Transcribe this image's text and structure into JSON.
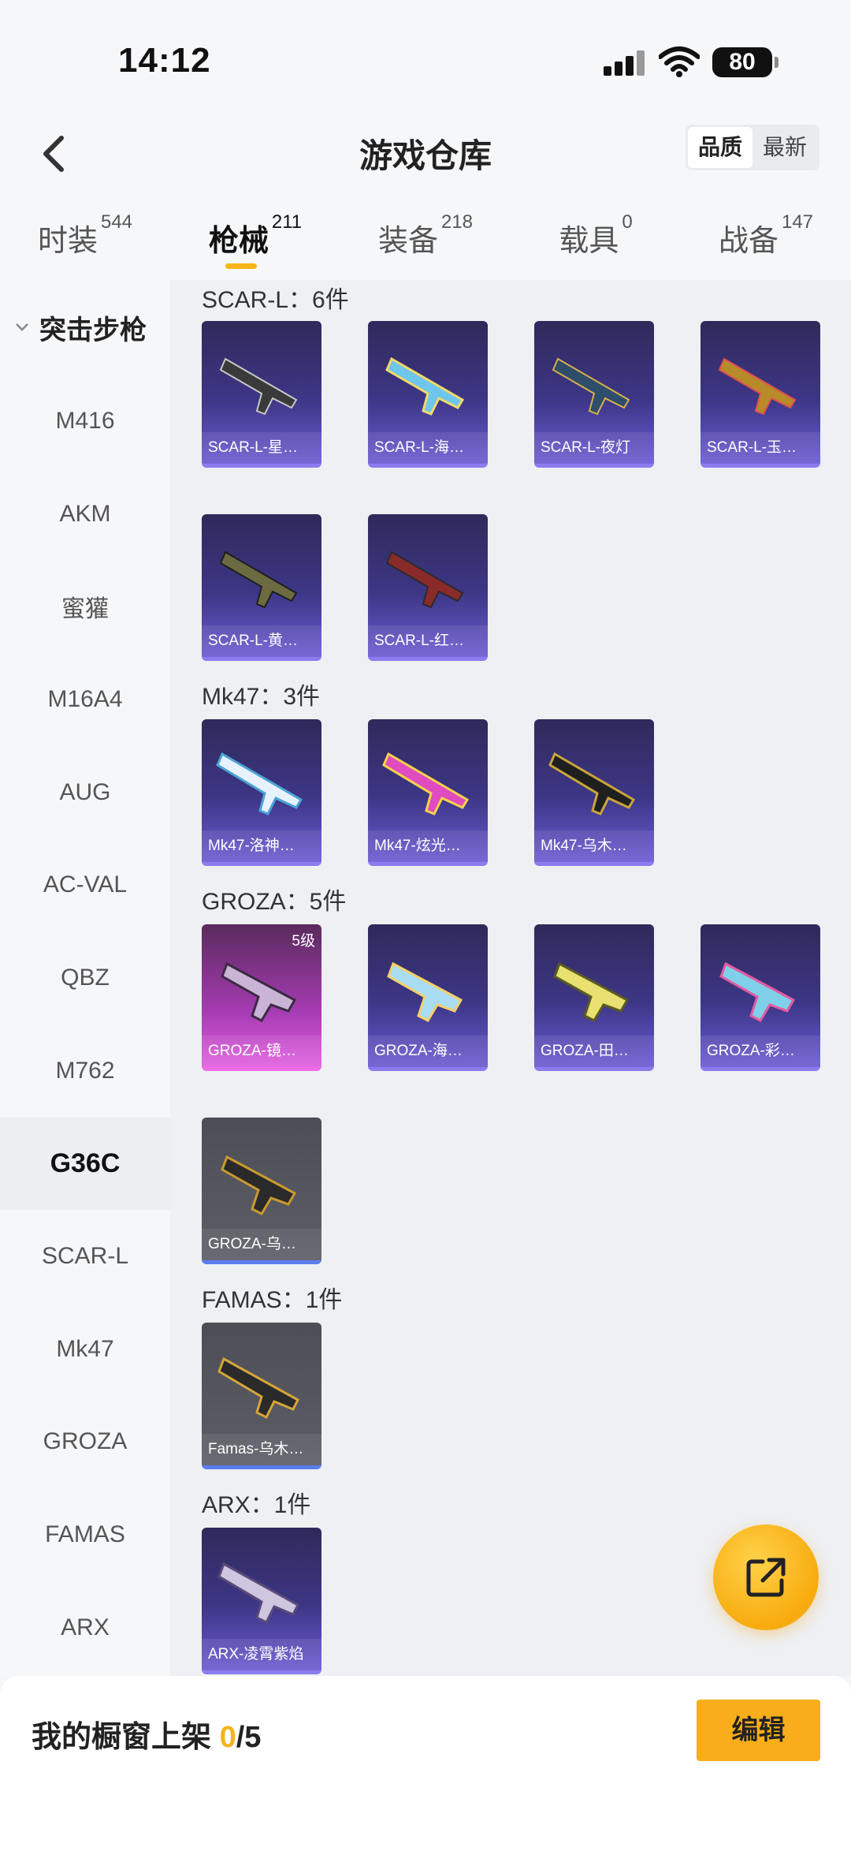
{
  "status_bar": {
    "time": "14:12",
    "battery": "80"
  },
  "header": {
    "title": "游戏仓库",
    "sort_options": [
      "品质",
      "最新"
    ]
  },
  "tabs": [
    {
      "label": "时装",
      "count": "544"
    },
    {
      "label": "枪械",
      "count": "211"
    },
    {
      "label": "装备",
      "count": "218"
    },
    {
      "label": "载具",
      "count": "0"
    },
    {
      "label": "战备",
      "count": "147"
    }
  ],
  "sidebar": {
    "category": "突击步枪",
    "items": [
      "M416",
      "AKM",
      "蜜獾",
      "M16A4",
      "AUG",
      "AC-VAL",
      "QBZ",
      "M762",
      "G36C",
      "SCAR-L",
      "Mk47",
      "GROZA",
      "FAMAS",
      "ARX"
    ],
    "active": "G36C"
  },
  "sections": [
    {
      "title": "SCAR-L：6件",
      "cards": [
        "SCAR-L-星…",
        "SCAR-L-海…",
        "SCAR-L-夜灯",
        "SCAR-L-玉…",
        "SCAR-L-黄…",
        "SCAR-L-红…"
      ]
    },
    {
      "title": "Mk47：3件",
      "cards": [
        "Mk47-洛神…",
        "Mk47-炫光…",
        "Mk47-乌木…"
      ]
    },
    {
      "title": "GROZA：5件",
      "cards": [
        "GROZA-镜…",
        "GROZA-海…",
        "GROZA-田…",
        "GROZA-彩…",
        "GROZA-乌…"
      ],
      "level_badge": "5级"
    },
    {
      "title": "FAMAS：1件",
      "cards": [
        "Famas-乌木…"
      ]
    },
    {
      "title": "ARX：1件",
      "cards": [
        "ARX-凌霄紫焰"
      ]
    }
  ],
  "bottom_bar": {
    "label": "我的橱窗上架 ",
    "current": "0",
    "total": "/5",
    "edit_label": "编辑"
  },
  "colors": {
    "accent": "#f8ae1a",
    "purple_card": "#3d3686",
    "pink_card": "#a43bb1",
    "grey_card": "#55565e"
  },
  "icons": {
    "back": "chevron-left-icon",
    "share": "external-link-icon",
    "collapse": "chevron-down-icon"
  }
}
